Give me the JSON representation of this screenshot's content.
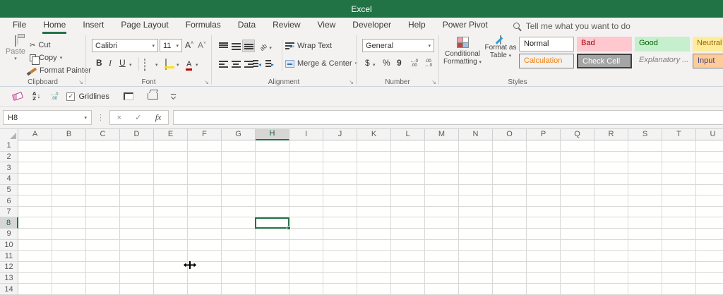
{
  "app": {
    "title": "Excel"
  },
  "menubar": {
    "tabs": [
      {
        "label": "File"
      },
      {
        "label": "Home",
        "active": true
      },
      {
        "label": "Insert"
      },
      {
        "label": "Page Layout"
      },
      {
        "label": "Formulas"
      },
      {
        "label": "Data"
      },
      {
        "label": "Review"
      },
      {
        "label": "View"
      },
      {
        "label": "Developer"
      },
      {
        "label": "Help"
      },
      {
        "label": "Power Pivot"
      }
    ],
    "search_placeholder": "Tell me what you want to do"
  },
  "ribbon": {
    "clipboard": {
      "label": "Clipboard",
      "paste": "Paste",
      "cut": "Cut",
      "copy": "Copy",
      "format_painter": "Format Painter"
    },
    "font": {
      "label": "Font",
      "family": "Calibri",
      "size": "11",
      "bold": "B",
      "italic": "I",
      "underline": "U",
      "grow": "A",
      "shrink": "A"
    },
    "alignment": {
      "label": "Alignment",
      "wrap_text": "Wrap Text",
      "merge_center": "Merge & Center",
      "orientation": "ab"
    },
    "number": {
      "label": "Number",
      "format": "General",
      "currency": "$",
      "percent": "%",
      "comma": "9"
    },
    "styles": {
      "label": "Styles",
      "conditional_line1": "Conditional",
      "conditional_line2": "Formatting",
      "format_table_line1": "Format as",
      "format_table_line2": "Table",
      "gallery": [
        {
          "name": "Normal",
          "bg": "#ffffff",
          "color": "#1f1f1f",
          "border": "1px solid #ababab"
        },
        {
          "name": "Bad",
          "bg": "#ffc7ce",
          "color": "#9c0006",
          "border": "none"
        },
        {
          "name": "Good",
          "bg": "#c6efce",
          "color": "#006100",
          "border": "none"
        },
        {
          "name": "Neutral",
          "bg": "#ffeb9c",
          "color": "#9c6500",
          "border": "none"
        },
        {
          "name": "Calculation",
          "bg": "#f2f2f2",
          "color": "#fa7d00",
          "border": "1px solid #7f7f7f"
        },
        {
          "name": "Check Cell",
          "bg": "#a5a5a5",
          "color": "#ffffff",
          "border": "2px solid #3f3f3f"
        },
        {
          "name": "Explanatory ...",
          "bg": "transparent",
          "color": "#7f7f7f",
          "border": "none",
          "italic": true
        },
        {
          "name": "Input",
          "bg": "#ffcc99",
          "color": "#3f3f76",
          "border": "1px solid #7f7f7f"
        }
      ]
    }
  },
  "quick_toolbar": {
    "gridlines_label": "Gridlines",
    "gridlines_checked": true
  },
  "formula_bar": {
    "name_box_value": "H8",
    "fx_label": "fx",
    "formula_value": ""
  },
  "grid": {
    "columns": [
      "A",
      "B",
      "C",
      "D",
      "E",
      "F",
      "G",
      "H",
      "I",
      "J",
      "K",
      "L",
      "M",
      "N",
      "O",
      "P",
      "Q",
      "R",
      "S",
      "T",
      "U"
    ],
    "rows": [
      1,
      2,
      3,
      4,
      5,
      6,
      7,
      8,
      9,
      10,
      11,
      12,
      13,
      14
    ],
    "selected_cell": "H8",
    "selected_column": "H",
    "selected_row": 8
  },
  "icons": {
    "scissors": "✂",
    "dropdown": "▾",
    "launcher": "↘",
    "cancel": "×",
    "check": "✓",
    "dots": "⋮",
    "sort_a": "A",
    "sort_z": "Z",
    "sort_arrow": "↓",
    "decimal_left_top": "←.0",
    "decimal_left_bottom": ".00",
    "decimal_right_top": ".00",
    "decimal_right_bottom": "→.0"
  },
  "colors": {
    "accent_green": "#217346",
    "chrome_bg": "#f3f2f1",
    "gridline": "#d9d9d9"
  }
}
